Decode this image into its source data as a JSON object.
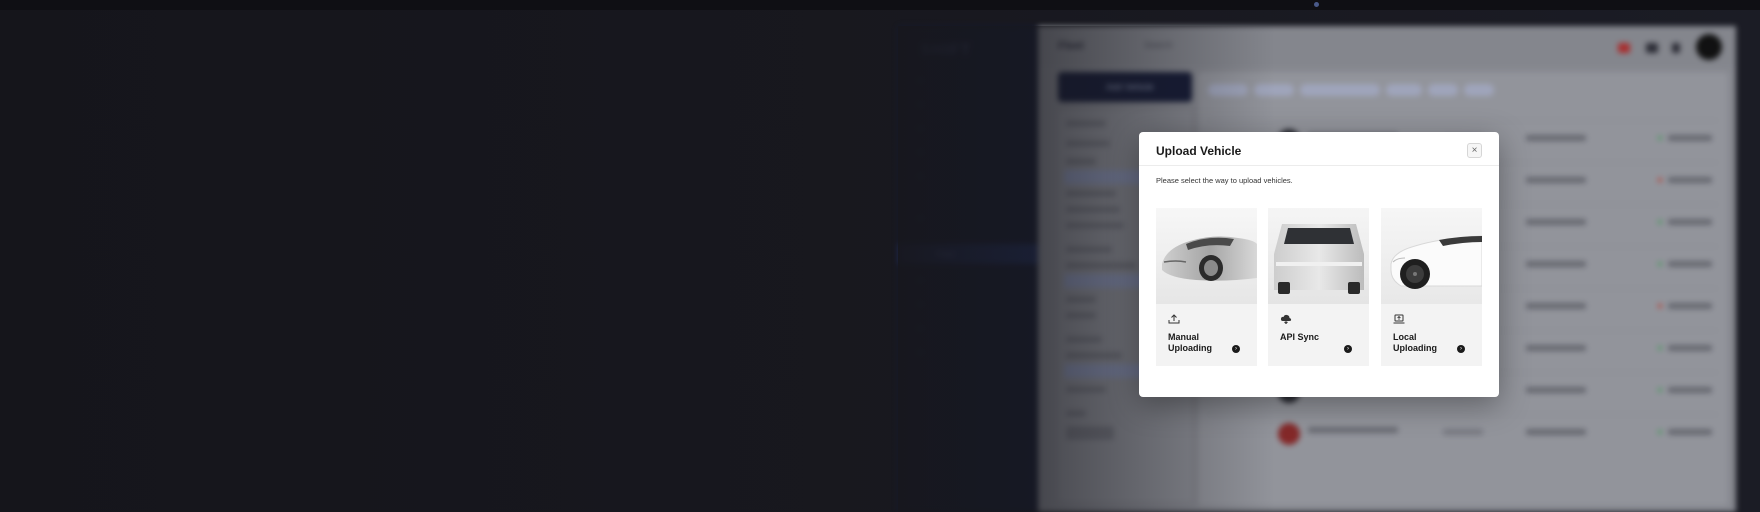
{
  "app": {
    "logo": "SHIFT",
    "title": "Fleet",
    "search_placeholder": "Search",
    "add_button_label": "Add Vehicle",
    "filter_label": "Filter",
    "filter_clear": "Clear all",
    "sidebar_active": "Fleet"
  },
  "modal": {
    "title": "Upload Vehicle",
    "close_icon": "×",
    "description": "Please select the way to upload vehicles.",
    "options": [
      {
        "label": "Manual Uploading",
        "icon": "upload-icon",
        "arrow": "›"
      },
      {
        "label": "API Sync",
        "icon": "cloud-sync-icon",
        "arrow": "›"
      },
      {
        "label": "Local Uploading",
        "icon": "laptop-upload-icon",
        "arrow": "›"
      }
    ]
  },
  "colors": {
    "backdrop": "#17171d",
    "modal_bg": "#ffffff",
    "card_bg": "#f3f3f3",
    "accent": "#1d3fb0"
  }
}
